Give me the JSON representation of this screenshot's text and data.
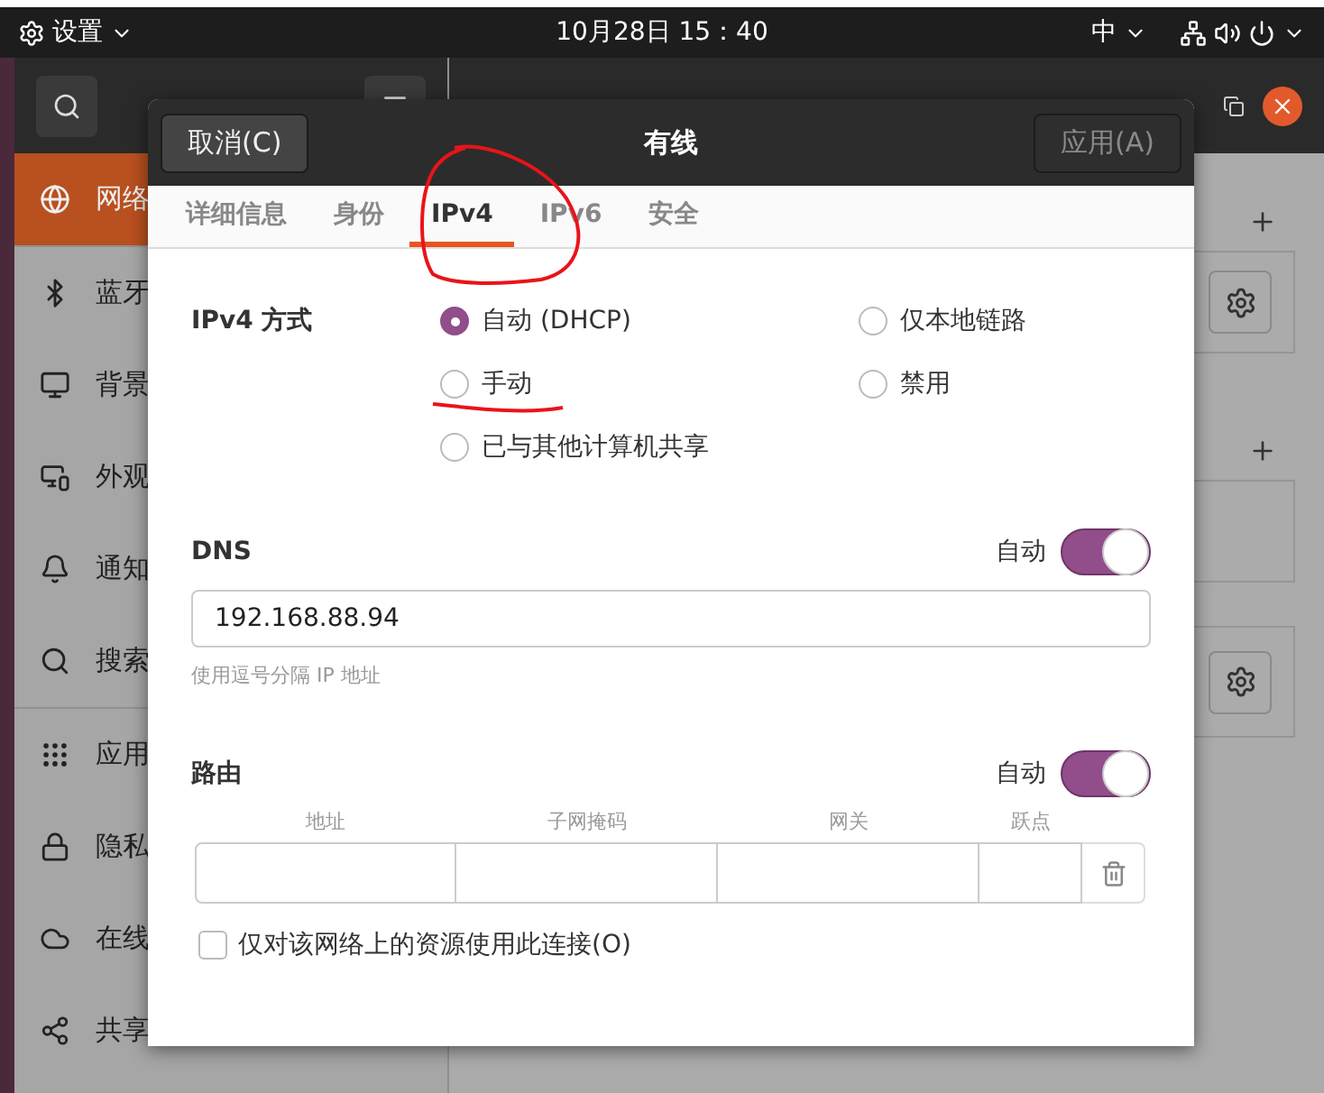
{
  "top_bar": {
    "app_menu": "设置",
    "clock": "10月28日 15：40",
    "input_method": "中"
  },
  "settings": {
    "sidebar": [
      {
        "label": "网络",
        "selected": true
      },
      {
        "label": "蓝牙",
        "selected": false
      },
      {
        "label": "背景",
        "selected": false
      },
      {
        "label": "外观",
        "selected": false
      },
      {
        "label": "通知",
        "selected": false
      },
      {
        "label": "搜索",
        "selected": false
      },
      {
        "label": "应用",
        "selected": false
      },
      {
        "label": "隐私",
        "selected": false
      },
      {
        "label": "在线",
        "selected": false
      },
      {
        "label": "共享",
        "selected": false
      }
    ]
  },
  "dialog": {
    "title": "有线",
    "cancel": "取消(C)",
    "apply": {
      "label": "应用(A)",
      "disabled": true
    },
    "tabs": [
      {
        "label": "详细信息",
        "selected": false
      },
      {
        "label": "身份",
        "selected": false
      },
      {
        "label": "IPv4",
        "selected": true
      },
      {
        "label": "IPv6",
        "selected": false
      },
      {
        "label": "安全",
        "selected": false
      }
    ],
    "ipv4_method": {
      "label": "IPv4 方式",
      "options": [
        {
          "label": "自动 (DHCP)",
          "selected": true
        },
        {
          "label": "仅本地链路",
          "selected": false
        },
        {
          "label": "手动",
          "selected": false
        },
        {
          "label": "禁用",
          "selected": false
        },
        {
          "label": "已与其他计算机共享",
          "selected": false
        }
      ]
    },
    "dns": {
      "label": "DNS",
      "auto_label": "自动",
      "auto_on": true,
      "value": "192.168.88.94",
      "hint": "使用逗号分隔 IP 地址"
    },
    "routes": {
      "label": "路由",
      "auto_label": "自动",
      "auto_on": true,
      "columns": [
        "地址",
        "子网掩码",
        "网关",
        "跃点"
      ]
    },
    "restrict_checkbox": {
      "label": "仅对该网络上的资源使用此连接(O)",
      "checked": false
    }
  }
}
